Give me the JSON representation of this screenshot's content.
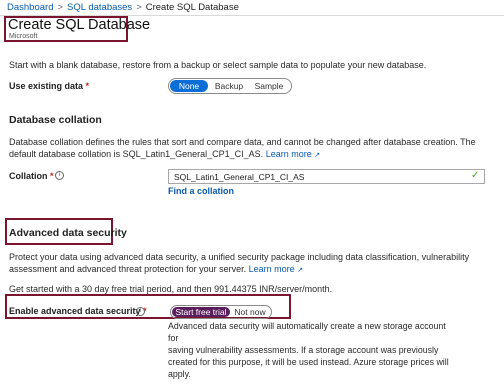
{
  "breadcrumb": {
    "items": [
      "Dashboard",
      "SQL databases"
    ],
    "current": "Create SQL Database"
  },
  "header": {
    "title": "Create SQL Database",
    "subtitle": "Microsoft"
  },
  "intro": "Start with a blank database, restore from a backup or select sample data to populate your new database.",
  "existing_data": {
    "label": "Use existing data",
    "required": "*",
    "options": [
      "None",
      "Backup",
      "Sample"
    ],
    "selected": "None"
  },
  "collation_section": {
    "heading": "Database collation",
    "desc_line1": "Database collation defines the rules that sort and compare data, and cannot be changed after database creation. The",
    "desc_line2": "default database collation is SQL_Latin1_General_CP1_CI_AS.",
    "learn_more": "Learn more",
    "label": "Collation",
    "required": "*",
    "value": "SQL_Latin1_General_CP1_CI_AS",
    "find_link": "Find a collation"
  },
  "security_section": {
    "heading": "Advanced data security",
    "desc_line1": "Protect your data using advanced data security, a unified security package including data classification, vulnerability",
    "desc_line2": "assessment and advanced threat protection for your server.",
    "learn_more": "Learn more",
    "trial_text": "Get started with a 30 day free trial period, and then 991.44375 INR/server/month.",
    "enable_label": "Enable advanced data security",
    "required": "*",
    "options": [
      "Start free trial",
      "Not now"
    ],
    "selected": "Start free trial",
    "note_lines": [
      "Advanced data security will automatically create a new storage account for",
      "saving vulnerability assessments. If a storage account was previously",
      "created for this purpose, it will be used instead. Azure storage prices will",
      "apply."
    ]
  },
  "colors": {
    "link": "#0b5cad",
    "accent": "#0b6ed6",
    "highlight_border": "#7a1530",
    "toggle_on": "#5a1e5c"
  }
}
